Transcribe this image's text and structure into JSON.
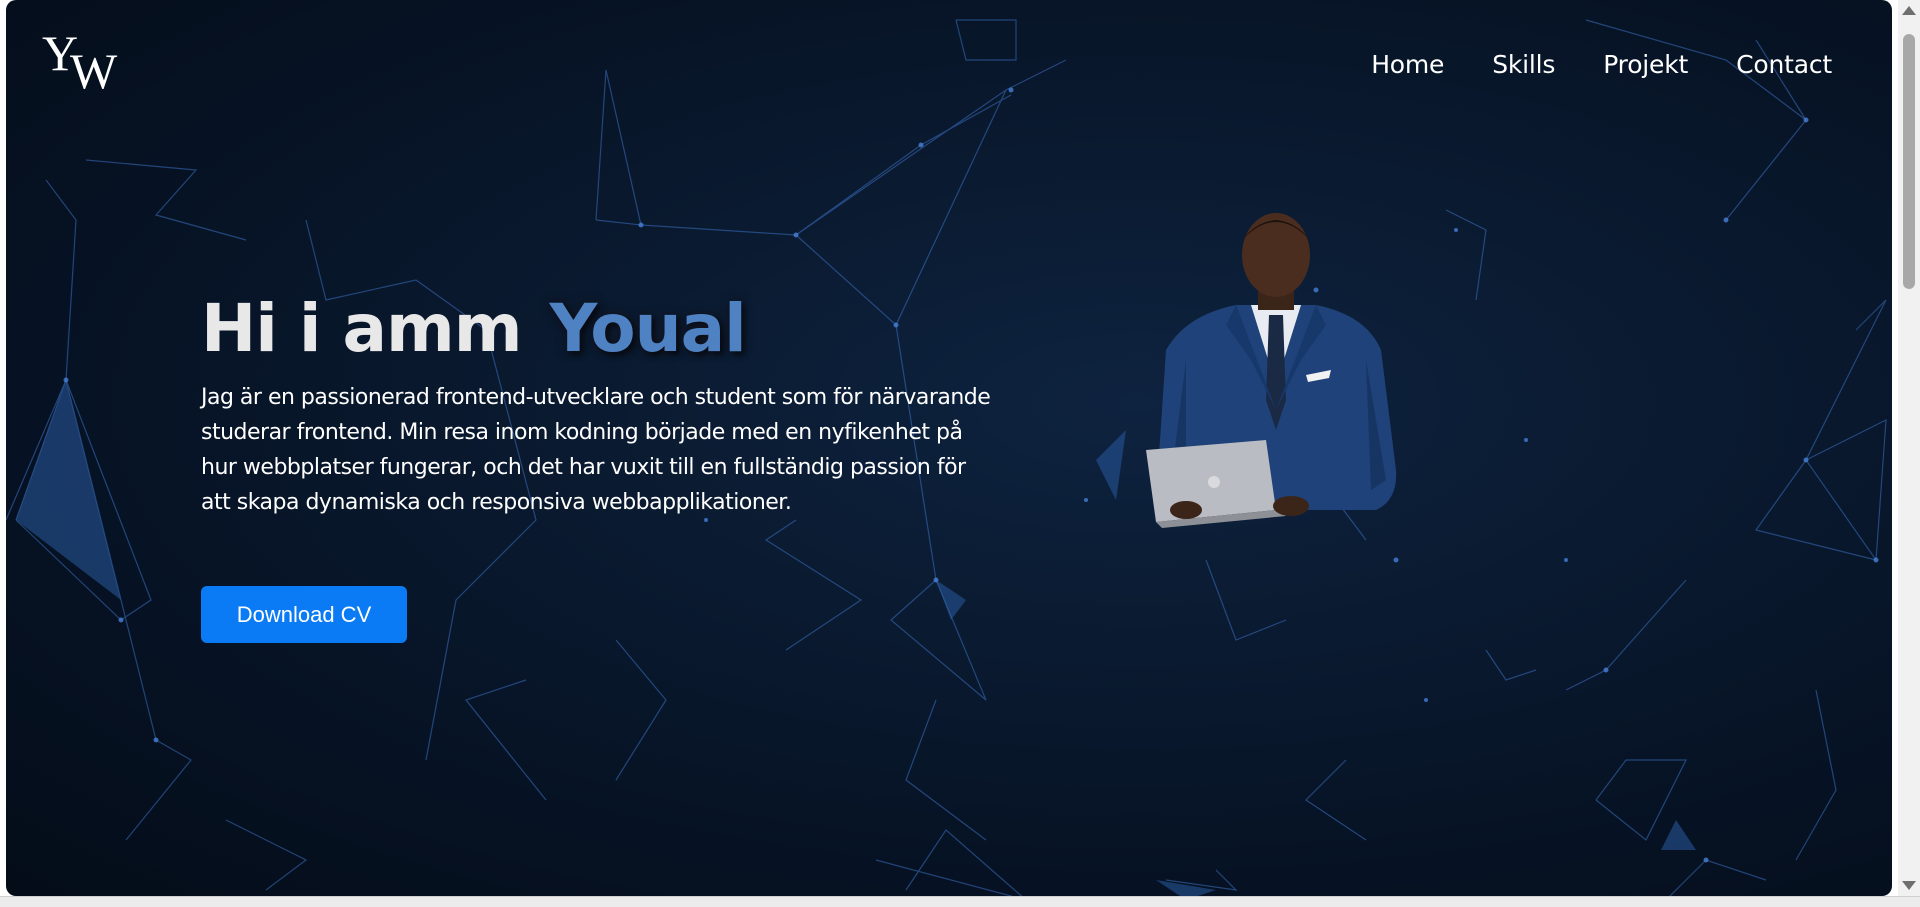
{
  "brand": {
    "logo_y": "Y",
    "logo_w": "W"
  },
  "nav": {
    "items": [
      "Home",
      "Skills",
      "Projekt",
      "Contact"
    ]
  },
  "hero": {
    "greeting": "Hi i amm",
    "name": "Youal",
    "description": "Jag är en passionerad frontend-utvecklare och student som för närvarande studerar frontend. Min resa inom kodning började med en nyfikenhet på hur webbplatser fungerar, och det har vuxit till en fullständig passion för att skapa dynamiska och responsiva webbapplikationer.",
    "cv_button": "Download CV",
    "portrait": "man-in-blue-suit-holding-laptop"
  },
  "colors": {
    "background": "#061223",
    "accent_name": "#4f82c3",
    "button": "#0a7bf5",
    "network_lines": "#3a6fc0"
  },
  "icons": [
    "scroll-up-arrow-icon",
    "scroll-down-arrow-icon"
  ]
}
